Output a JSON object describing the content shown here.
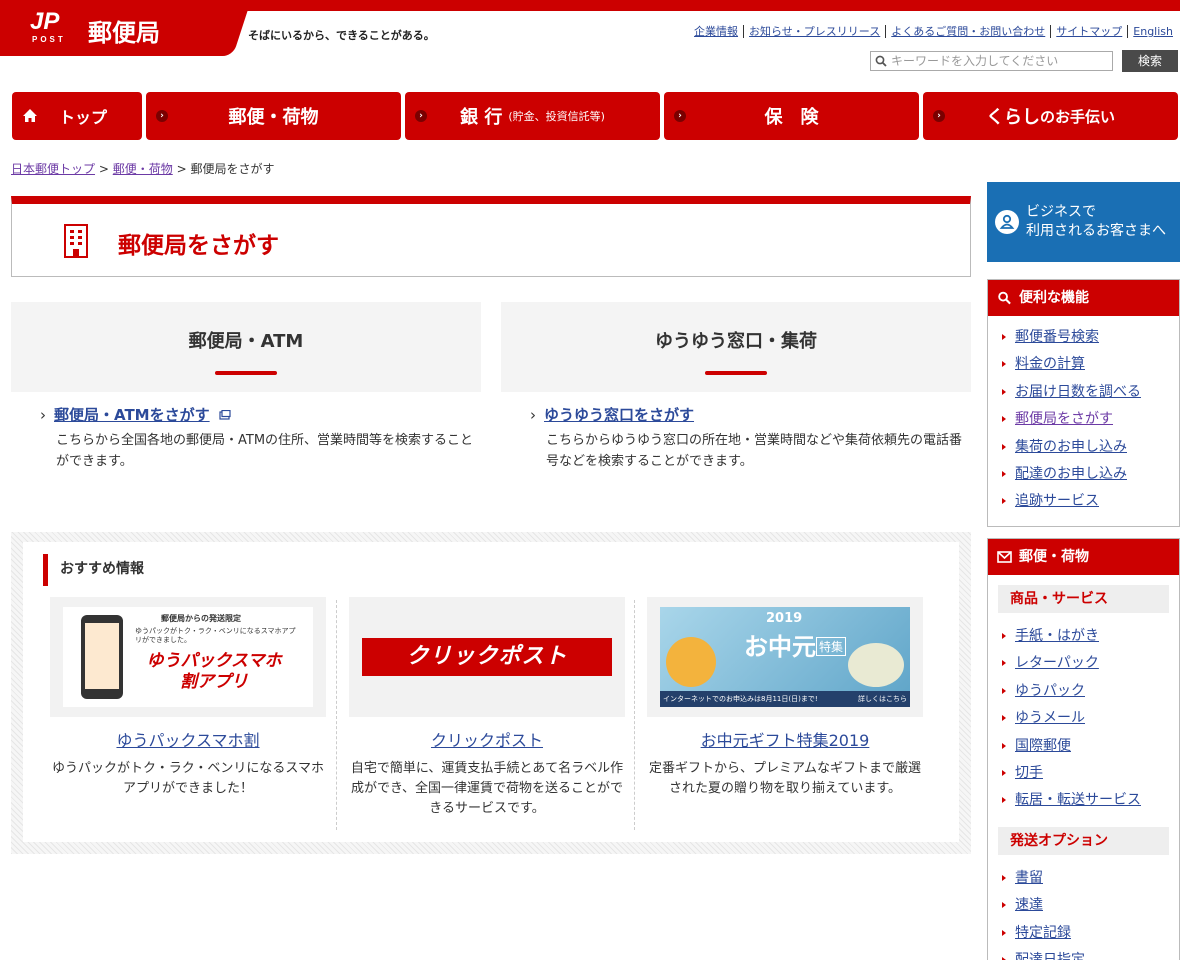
{
  "header": {
    "brand": "郵便局",
    "jp_logo": "JP",
    "post_logo": "POST",
    "tagline": "そばにいるから、できることがある。",
    "links": [
      "企業情報",
      "お知らせ・プレスリリース",
      "よくあるご質問・お問い合わせ",
      "サイトマップ",
      "English"
    ],
    "search_placeholder": "キーワードを入力してください",
    "search_button": "検索"
  },
  "nav": [
    {
      "label": "トップ",
      "sub": ""
    },
    {
      "label": "郵便・荷物",
      "sub": ""
    },
    {
      "label": "銀 行",
      "sub": "(貯金、投資信託等)"
    },
    {
      "label": "保　険",
      "sub": ""
    },
    {
      "label": "くらし",
      "sub": "のお手伝い"
    }
  ],
  "breadcrumb": {
    "items": [
      "日本郵便トップ",
      "郵便・荷物"
    ],
    "current": "郵便局をさがす",
    "sep": ">"
  },
  "page_title": "郵便局をさがす",
  "panels": [
    {
      "heading": "郵便局・ATM",
      "link": "郵便局・ATMをさがす",
      "desc": "こちらから全国各地の郵便局・ATMの住所、営業時間等を検索することができます。"
    },
    {
      "heading": "ゆうゆう窓口・集荷",
      "link": "ゆうゆう窓口をさがす",
      "desc": "こちらからゆうゆう窓口の所在地・営業時間などや集荷依頼先の電話番号などを検索することができます。"
    }
  ],
  "recommend": {
    "title": "おすすめ情報",
    "cards": [
      {
        "banner_top": "郵便局からの発送限定",
        "banner_mid": "ゆうパックがトク・ラク・ベンリになるスマホアプリができました。",
        "banner_main": "ゆうパックスマホ割アプリ",
        "title": "ゆうパックスマホ割",
        "desc": "ゆうパックがトク・ラク・ベンリになるスマホアプリができました！"
      },
      {
        "banner_main": "クリックポスト",
        "title": "クリックポスト",
        "desc": "自宅で簡単に、運賃支払手続とあて名ラベル作成ができ、全国一律運賃で荷物を送ることができるサービスです。"
      },
      {
        "banner_year": "2019",
        "banner_main": "お中元",
        "banner_tag": "特集",
        "banner_foot": "インターネットでのお申込みは8月11日(日)まで!",
        "banner_more": "詳しくはこちら",
        "title": "お中元ギフト特集2019",
        "desc": "定番ギフトから、プレミアムなギフトまで厳選された夏の贈り物を取り揃えています。"
      }
    ]
  },
  "sidebar": {
    "business": "ビジネスで利用されるお客さまへ",
    "business_l1": "ビジネスで",
    "business_l2": "利用されるお客さまへ",
    "useful_title": "便利な機能",
    "useful_items": [
      "郵便番号検索",
      "料金の計算",
      "お届け日数を調べる",
      "郵便局をさがす",
      "集荷のお申し込み",
      "配達のお申し込み",
      "追跡サービス"
    ],
    "mail_title": "郵便・荷物",
    "products_title": "商品・サービス",
    "products": [
      "手紙・はがき",
      "レターパック",
      "ゆうパック",
      "ゆうメール",
      "国際郵便",
      "切手",
      "転居・転送サービス"
    ],
    "options_title": "発送オプション",
    "options": [
      "書留",
      "速達",
      "特定記録",
      "配達日指定"
    ]
  },
  "colors": {
    "brand_red": "#cc0000",
    "link_blue": "#2c4a9a",
    "business_blue": "#1a6fb4"
  }
}
